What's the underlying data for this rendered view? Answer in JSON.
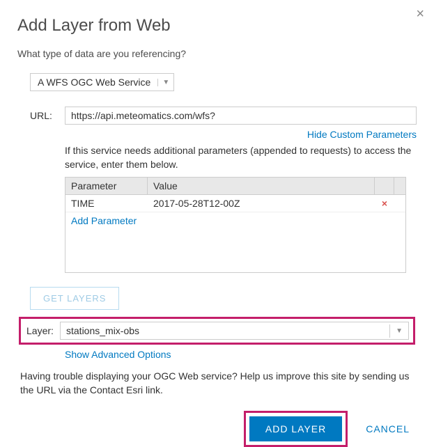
{
  "dialog": {
    "title": "Add Layer from Web",
    "prompt": "What type of data are you referencing?",
    "close_icon": "×"
  },
  "type_select": {
    "value": "A WFS OGC Web Service"
  },
  "url": {
    "label": "URL:",
    "value": "https://api.meteomatics.com/wfs?"
  },
  "links": {
    "hide_custom": "Hide Custom Parameters",
    "add_parameter": "Add Parameter",
    "show_advanced": "Show Advanced Options"
  },
  "instructions": "If this service needs additional parameters (appended to requests) to access the service, enter them below.",
  "params_table": {
    "header_param": "Parameter",
    "header_value": "Value",
    "rows": [
      {
        "param": "TIME",
        "value": "2017-05-28T12-00Z"
      }
    ],
    "delete_icon": "×"
  },
  "get_layers_label": "GET LAYERS",
  "layer": {
    "label": "Layer:",
    "value": "stations_mix-obs"
  },
  "help_text": "Having trouble displaying your OGC Web service? Help us improve this site by sending us the URL via the Contact Esri link.",
  "footer": {
    "add_layer": "ADD LAYER",
    "cancel": "CANCEL"
  }
}
